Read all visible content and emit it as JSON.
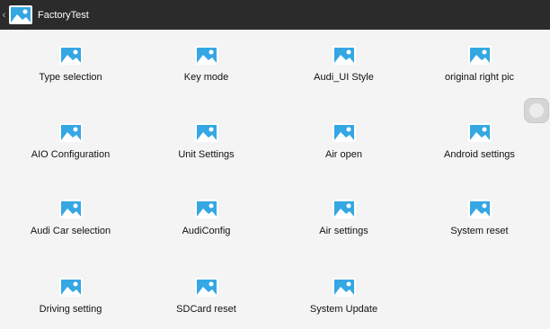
{
  "header": {
    "title": "FactoryTest",
    "back_glyph": "‹",
    "app_icon": "image-placeholder-icon"
  },
  "colors": {
    "titlebar": "#2b2b2b",
    "background": "#f4f4f4",
    "icon_sky": "#35a7e3",
    "icon_mountain": "#ffffff"
  },
  "grid": {
    "items": [
      {
        "label": "Type selection",
        "icon": "image-placeholder-icon"
      },
      {
        "label": "Key mode",
        "icon": "image-placeholder-icon"
      },
      {
        "label": "Audi_UI Style",
        "icon": "image-placeholder-icon"
      },
      {
        "label": "original right pic",
        "icon": "image-placeholder-icon"
      },
      {
        "label": "AIO Configuration",
        "icon": "image-placeholder-icon"
      },
      {
        "label": "Unit Settings",
        "icon": "image-placeholder-icon"
      },
      {
        "label": "Air open",
        "icon": "image-placeholder-icon"
      },
      {
        "label": "Android settings",
        "icon": "image-placeholder-icon"
      },
      {
        "label": "Audi Car selection",
        "icon": "image-placeholder-icon"
      },
      {
        "label": "AudiConfig",
        "icon": "image-placeholder-icon"
      },
      {
        "label": "Air settings",
        "icon": "image-placeholder-icon"
      },
      {
        "label": "System reset",
        "icon": "image-placeholder-icon"
      },
      {
        "label": "Driving setting",
        "icon": "image-placeholder-icon"
      },
      {
        "label": "SDCard reset",
        "icon": "image-placeholder-icon"
      },
      {
        "label": "System Update",
        "icon": "image-placeholder-icon"
      }
    ]
  }
}
